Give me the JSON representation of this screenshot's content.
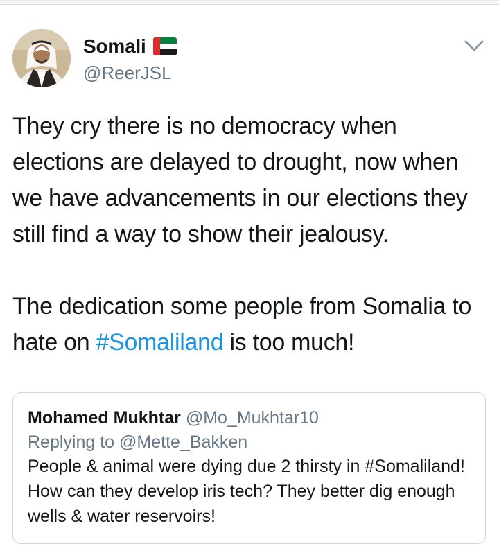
{
  "tweet": {
    "author_name": "Somali",
    "author_handle": "@ReerJSL",
    "flag_icon": "uae-flag-icon",
    "paragraph1": "They cry there is no democracy when elections are delayed to drought, now when we have advancements in our elections they still find a way to show their jealousy.",
    "paragraph2_before": "The dedication some people from Somalia to hate on ",
    "hashtag": "#Somaliland",
    "paragraph2_after": " is too much!"
  },
  "quoted_tweet": {
    "author_name": "Mohamed Mukhtar",
    "author_handle": "@Mo_Mukhtar10",
    "replying_to": "Replying to @Mette_Bakken",
    "text": "People & animal were dying due 2 thirsty in #Somaliland! How can they develop iris tech? They better dig enough wells & water reservoirs!"
  },
  "colors": {
    "hashtag": "#1b95e0",
    "secondary_text": "#657786",
    "border": "#ccd6dd"
  }
}
